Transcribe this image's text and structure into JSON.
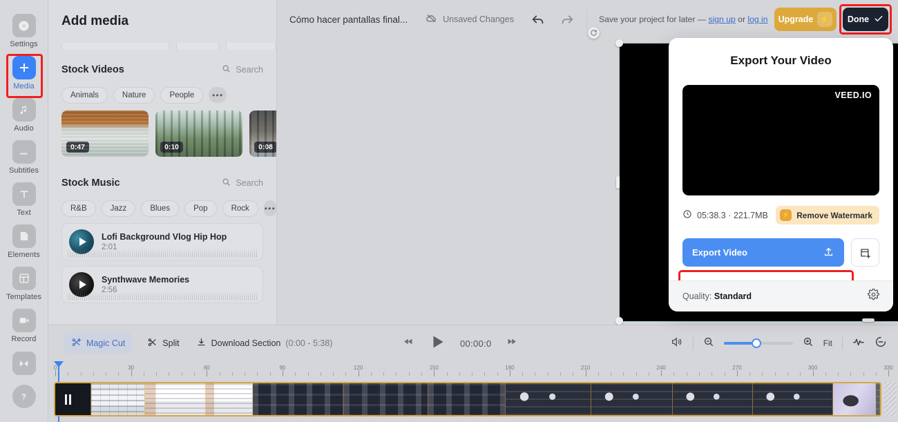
{
  "rail": {
    "items": [
      {
        "label": "Settings",
        "icon": "settings-icon",
        "active": false
      },
      {
        "label": "Media",
        "icon": "plus-icon",
        "active": true
      },
      {
        "label": "Audio",
        "icon": "music-note-icon",
        "active": false
      },
      {
        "label": "Subtitles",
        "icon": "subtitles-icon",
        "active": false
      },
      {
        "label": "Text",
        "icon": "text-icon",
        "active": false
      },
      {
        "label": "Elements",
        "icon": "elements-icon",
        "active": false
      },
      {
        "label": "Templates",
        "icon": "templates-icon",
        "active": false
      },
      {
        "label": "Record",
        "icon": "record-camera-icon",
        "active": false
      }
    ],
    "bottom_icons": [
      "bowtie-icon",
      "help-question-icon"
    ]
  },
  "panel": {
    "title": "Add media",
    "stock_videos": {
      "title": "Stock Videos",
      "search_label": "Search",
      "chips": [
        "Animals",
        "Nature",
        "People",
        "•••"
      ],
      "thumbs": [
        {
          "duration": "0:47",
          "alt": "aerial-beach-waves"
        },
        {
          "duration": "0:10",
          "alt": "bamboo-forest"
        },
        {
          "duration": "0:08",
          "alt": "mountain-slope"
        }
      ]
    },
    "stock_music": {
      "title": "Stock Music",
      "search_label": "Search",
      "chips": [
        "R&B",
        "Jazz",
        "Blues",
        "Pop",
        "Rock",
        "•••"
      ],
      "tracks": [
        {
          "name": "Lofi Background Vlog Hip Hop",
          "duration": "2:01"
        },
        {
          "name": "Synthwave Memories",
          "duration": "2:56"
        }
      ]
    }
  },
  "topbar": {
    "project_title": "Cómo hacer pantallas final...",
    "unsaved_label": "Unsaved Changes",
    "save_hint_prefix": "Save your project for later — ",
    "sign_up": "sign up",
    "save_hint_mid": " or ",
    "log_in": "log in",
    "upgrade_label": "Upgrade",
    "done_label": "Done"
  },
  "export": {
    "title": "Export Your Video",
    "watermark_logo": "VEED.IO",
    "meta": "05:38.3 · 221.7MB",
    "remove_watermark_label": "Remove Watermark",
    "export_button_label": "Export Video",
    "quality_label": "Quality: ",
    "quality_value": "Standard"
  },
  "bottombar": {
    "magic_cut_label": "Magic Cut",
    "split_label": "Split",
    "download_section_label": "Download Section",
    "download_section_range": "(0:00 - 5:38)",
    "timecode": "00:00:0",
    "fit_label": "Fit"
  },
  "timeline": {
    "ticks": [
      0,
      30,
      60,
      90,
      120,
      150,
      180,
      210,
      240,
      270,
      300,
      330
    ]
  },
  "colors": {
    "accent_blue": "#4b8ef2",
    "upgrade_gold": "#dda93c",
    "done_dark": "#1d2230",
    "highlight_red": "#ef2020",
    "track_border": "#d9a646"
  }
}
